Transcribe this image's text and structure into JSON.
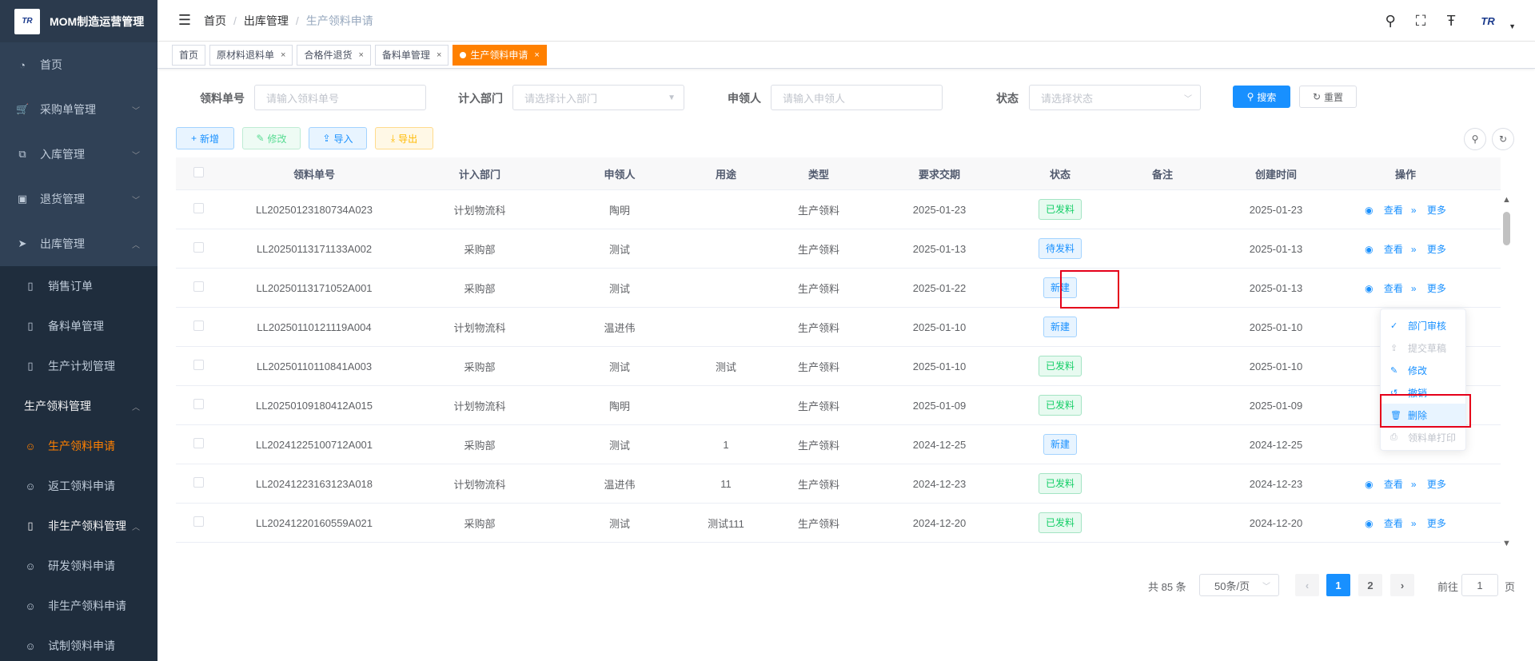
{
  "app": {
    "title": "MOM制造运营管理",
    "logo_text": "TR"
  },
  "sidebar": {
    "items": [
      {
        "label": "首页",
        "icon": "dashboard-icon"
      },
      {
        "label": "采购单管理",
        "icon": "cart-icon"
      },
      {
        "label": "入库管理",
        "icon": "external-link-icon"
      },
      {
        "label": "退货管理",
        "icon": "return-icon"
      },
      {
        "label": "出库管理",
        "icon": "send-icon"
      }
    ],
    "sub_items": [
      {
        "label": "销售订单",
        "icon": "book-icon"
      },
      {
        "label": "备料单管理",
        "icon": "book-icon"
      },
      {
        "label": "生产计划管理",
        "icon": "book-icon"
      },
      {
        "label": "生产领料管理",
        "icon": "none"
      },
      {
        "label": "生产领料申请",
        "icon": "person-icon"
      },
      {
        "label": "返工领料申请",
        "icon": "person-icon"
      },
      {
        "label": "非生产领料管理",
        "icon": "book-icon"
      },
      {
        "label": "研发领料申请",
        "icon": "person-icon"
      },
      {
        "label": "非生产领料申请",
        "icon": "person-icon"
      },
      {
        "label": "试制领料申请",
        "icon": "person-icon"
      }
    ]
  },
  "breadcrumb": [
    "首页",
    "出库管理",
    "生产领料申请"
  ],
  "tags": [
    {
      "label": "首页"
    },
    {
      "label": "原材料退料单"
    },
    {
      "label": "合格件退货"
    },
    {
      "label": "备料单管理"
    },
    {
      "label": "生产领料申请"
    }
  ],
  "search": {
    "order_label": "领料单号",
    "order_placeholder": "请输入领料单号",
    "dept_label": "计入部门",
    "dept_placeholder": "请选择计入部门",
    "applicant_label": "申领人",
    "applicant_placeholder": "请输入申领人",
    "status_label": "状态",
    "status_placeholder": "请选择状态",
    "search_btn": "搜索",
    "reset_btn": "重置"
  },
  "toolbar": {
    "add": "新增",
    "edit": "修改",
    "import": "导入",
    "export": "导出"
  },
  "table": {
    "headers": [
      "领料单号",
      "计入部门",
      "申领人",
      "用途",
      "类型",
      "要求交期",
      "状态",
      "备注",
      "创建时间",
      "操作"
    ],
    "rows": [
      {
        "no": "LL20250123180734A023",
        "dept": "计划物流科",
        "applicant": "陶明",
        "purpose": "",
        "type": "生产领料",
        "due": "2025-01-23",
        "status": "已发料",
        "remark": "",
        "created": "2025-01-23",
        "ops": true
      },
      {
        "no": "LL20250113171133A002",
        "dept": "采购部",
        "applicant": "测试",
        "purpose": "",
        "type": "生产领料",
        "due": "2025-01-13",
        "status": "待发料",
        "remark": "",
        "created": "2025-01-13",
        "ops": true
      },
      {
        "no": "LL20250113171052A001",
        "dept": "采购部",
        "applicant": "测试",
        "purpose": "",
        "type": "生产领料",
        "due": "2025-01-22",
        "status": "新建",
        "remark": "",
        "created": "2025-01-13",
        "ops": true
      },
      {
        "no": "LL20250110121119A004",
        "dept": "计划物流科",
        "applicant": "温进伟",
        "purpose": "",
        "type": "生产领料",
        "due": "2025-01-10",
        "status": "新建",
        "remark": "",
        "created": "2025-01-10",
        "ops": false
      },
      {
        "no": "LL20250110110841A003",
        "dept": "采购部",
        "applicant": "测试",
        "purpose": "测试",
        "type": "生产领料",
        "due": "2025-01-10",
        "status": "已发料",
        "remark": "",
        "created": "2025-01-10",
        "ops": false
      },
      {
        "no": "LL20250109180412A015",
        "dept": "计划物流科",
        "applicant": "陶明",
        "purpose": "",
        "type": "生产领料",
        "due": "2025-01-09",
        "status": "已发料",
        "remark": "",
        "created": "2025-01-09",
        "ops": false
      },
      {
        "no": "LL20241225100712A001",
        "dept": "采购部",
        "applicant": "测试",
        "purpose": "1",
        "type": "生产领料",
        "due": "2024-12-25",
        "status": "新建",
        "remark": "",
        "created": "2024-12-25",
        "ops": false
      },
      {
        "no": "LL20241223163123A018",
        "dept": "计划物流科",
        "applicant": "温进伟",
        "purpose": "11",
        "type": "生产领料",
        "due": "2024-12-23",
        "status": "已发料",
        "remark": "",
        "created": "2024-12-23",
        "ops": true
      },
      {
        "no": "LL20241220160559A021",
        "dept": "采购部",
        "applicant": "测试",
        "purpose": "测试111",
        "type": "生产领料",
        "due": "2024-12-20",
        "status": "已发料",
        "remark": "",
        "created": "2024-12-20",
        "ops": true
      }
    ],
    "op_view": "查看",
    "op_more": "更多"
  },
  "dropdown": {
    "items": [
      "部门审核",
      "提交草稿",
      "修改",
      "撤销",
      "删除",
      "领料单打印"
    ]
  },
  "pagination": {
    "total": "共 85 条",
    "page_size": "50条/页",
    "pages": [
      "1",
      "2"
    ],
    "goto_prefix": "前往",
    "goto_value": "1",
    "goto_suffix": "页"
  },
  "colors": {
    "sidebar_bg": "#304156",
    "active_orange": "#ff8000",
    "primary": "#1890ff",
    "success": "#13ce66",
    "highlight_red": "#e5001a"
  }
}
